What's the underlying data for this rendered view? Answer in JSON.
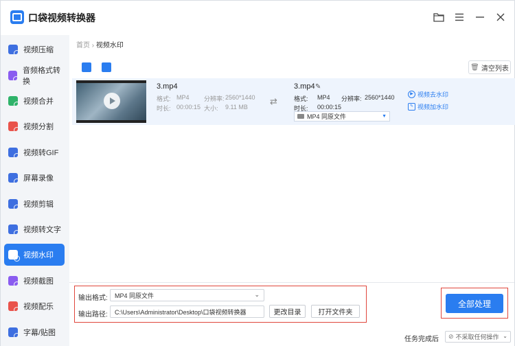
{
  "app": {
    "title": "口袋视频转换器"
  },
  "titlebar": {
    "folder_icon": "folder-icon",
    "menu_icon": "menu-icon",
    "minimize_icon": "minimize-icon",
    "close_icon": "close-icon"
  },
  "sidebar": {
    "items": [
      {
        "label": "视频压缩",
        "color": "#3e6fe0"
      },
      {
        "label": "音频格式转换",
        "color": "#8a5cf0"
      },
      {
        "label": "视频合并",
        "color": "#2fb36a"
      },
      {
        "label": "视频分割",
        "color": "#e9534b"
      },
      {
        "label": "视频转GIF",
        "color": "#3e6fe0"
      },
      {
        "label": "屏幕录像",
        "color": "#3e6fe0"
      },
      {
        "label": "视频剪辑",
        "color": "#3e6fe0"
      },
      {
        "label": "视频转文字",
        "color": "#3e6fe0"
      },
      {
        "label": "视频水印",
        "color": "#e9534b",
        "active": true
      },
      {
        "label": "视频截图",
        "color": "#8a5cf0"
      },
      {
        "label": "视频配乐",
        "color": "#e9534b"
      },
      {
        "label": "字幕/贴图",
        "color": "#3e6fe0"
      }
    ]
  },
  "breadcrumb": {
    "home": "首页",
    "sep": "›",
    "current": "视频水印"
  },
  "toolbar": {
    "add_file_icon": "add-file-icon",
    "add_folder_icon": "add-folder-icon",
    "clear_label": "清空列表"
  },
  "file": {
    "src": {
      "name": "3.mp4",
      "format_label": "格式:",
      "format": "MP4",
      "res_label": "分辨率:",
      "res": "2560*1440",
      "dur_label": "时长:",
      "duration": "00:00:15",
      "size_label": "大小:",
      "size": "9.11 MB"
    },
    "dst": {
      "name": "3.mp4",
      "format_label": "格式:",
      "format": "MP4",
      "res_label": "分辨率:",
      "res": "2560*1440",
      "dur_label": "时长:",
      "duration": "00:00:15",
      "select": "MP4   同原文件"
    },
    "actions": {
      "remove_wm": "视频去水印",
      "add_wm": "视频加水印"
    }
  },
  "output": {
    "format_label": "输出格式:",
    "format_value": "MP4   同原文件",
    "path_label": "输出路径:",
    "path_value": "C:\\Users\\Administrator\\Desktop\\口袋视频转换器",
    "change_dir": "更改目录",
    "open_folder": "打开文件夹",
    "process_all": "全部处理"
  },
  "status": {
    "after_label": "任务完成后",
    "after_value": "不采取任何操作"
  },
  "colors": {
    "accent": "#2a7df0",
    "highlight": "#e0453b"
  }
}
